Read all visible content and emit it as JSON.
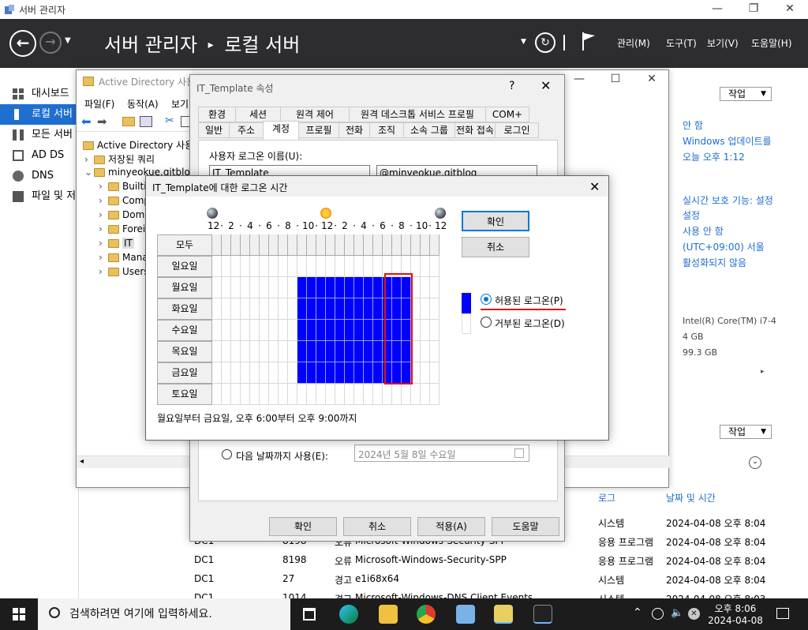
{
  "server_manager": {
    "window_title": "서버 관리자",
    "breadcrumb_root": "서버 관리자",
    "breadcrumb_sep": "▸",
    "breadcrumb_page": "로컬 서버",
    "menus": [
      "관리(M)",
      "도구(T)",
      "보기(V)",
      "도움말(H)"
    ],
    "sidebar": [
      "대시보드",
      "로컬 서버",
      "모든 서버",
      "AD DS",
      "DNS",
      "파일 및 저장소 서비스"
    ],
    "right_panel": {
      "task_label": "작업",
      "lines": [
        "안 함",
        "Windows 업데이트를",
        "오늘 오후 1:12",
        "실시간 보호 기능: 설정",
        "설정",
        "사용 안 함",
        "(UTC+09:00) 서울",
        "활성화되지 않음",
        "Intel(R) Core(TM) i7-4",
        "4 GB",
        "99.3 GB"
      ],
      "task_label2": "작업"
    },
    "events": {
      "col_log": "로그",
      "col_datetime": "날짜 및 시간",
      "rows": [
        {
          "server": "",
          "id": "",
          "level": "",
          "source": "",
          "log": "시스템",
          "time": "2024-04-08 오후 8:04"
        },
        {
          "server": "DC1",
          "id": "8198",
          "level": "오류",
          "source": "Microsoft-Windows-Security-SPP",
          "log": "응용 프로그램",
          "time": "2024-04-08 오후 8:04"
        },
        {
          "server": "DC1",
          "id": "8198",
          "level": "오류",
          "source": "Microsoft-Windows-Security-SPP",
          "log": "응용 프로그램",
          "time": "2024-04-08 오후 8:04"
        },
        {
          "server": "DC1",
          "id": "27",
          "level": "경고",
          "source": "e1i68x64",
          "log": "시스템",
          "time": "2024-04-08 오후 8:04"
        },
        {
          "server": "DC1",
          "id": "1014",
          "level": "경고",
          "source": "Microsoft-Windows-DNS Client Events",
          "log": "시스템",
          "time": "2024-04-08 오후 8:03"
        }
      ]
    }
  },
  "ad_window": {
    "title": "Active Directory 사용자 및 컴퓨터",
    "menus": [
      "파일(F)",
      "동작(A)",
      "보기"
    ],
    "tree": [
      {
        "label": "Active Directory 사용자",
        "indent": 0
      },
      {
        "label": "저장된 쿼리",
        "indent": 1
      },
      {
        "label": "minyeokue.gitblog",
        "indent": 1
      },
      {
        "label": "Builtin",
        "indent": 2
      },
      {
        "label": "Computers",
        "indent": 2
      },
      {
        "label": "Domain",
        "indent": 2
      },
      {
        "label": "Foreign",
        "indent": 2
      },
      {
        "label": "IT",
        "indent": 2
      },
      {
        "label": "Managed",
        "indent": 2
      },
      {
        "label": "Users",
        "indent": 2
      }
    ]
  },
  "properties": {
    "title": "IT_Template 속성",
    "help": "?",
    "tabs_row1": [
      "환경",
      "세션",
      "원격 제어",
      "원격 데스크톱 서비스 프로필",
      "COM+"
    ],
    "tabs_row2": [
      "일반",
      "주소",
      "계정",
      "프로필",
      "전화",
      "조직",
      "소속 그룹",
      "전화 접속",
      "로그인"
    ],
    "logon_name_label": "사용자 로그온 이름(U):",
    "logon_name_value": "IT_Template",
    "domain_value": "@minyeokue.gitblog",
    "expire_option": "다음 날짜까지 사용(E):",
    "expire_date": "2024년   5월   8일 수요일",
    "buttons": [
      "확인",
      "취소",
      "적용(A)",
      "도움말"
    ]
  },
  "logon_hours": {
    "title": "IT_Template에 대한 로그온 시간",
    "all_label": "모두",
    "hour_labels": [
      "12",
      "·",
      "2",
      "·",
      "4",
      "·",
      "6",
      "·",
      "8",
      "·",
      "10",
      "·",
      "12",
      "·",
      "2",
      "·",
      "4",
      "·",
      "6",
      "·",
      "8",
      "·",
      "10",
      "·",
      "12"
    ],
    "days": [
      "일요일",
      "월요일",
      "화요일",
      "수요일",
      "목요일",
      "금요일",
      "토요일"
    ],
    "allowed": [
      [],
      [
        9,
        10,
        11,
        12,
        13,
        14,
        15,
        16,
        17,
        18,
        19,
        20
      ],
      [
        9,
        10,
        11,
        12,
        13,
        14,
        15,
        16,
        17,
        18,
        19,
        20
      ],
      [
        9,
        10,
        11,
        12,
        13,
        14,
        15,
        16,
        17,
        18,
        19,
        20
      ],
      [
        9,
        10,
        11,
        12,
        13,
        14,
        15,
        16,
        17,
        18,
        19,
        20
      ],
      [
        9,
        10,
        11,
        12,
        13,
        14,
        15,
        16,
        17,
        18,
        19,
        20
      ],
      []
    ],
    "ok": "확인",
    "cancel": "취소",
    "allowed_label": "허용된 로그온(P)",
    "denied_label": "거부된 로그온(D)",
    "status": "월요일부터 금요일, 오후 6:00부터 오후 9:00까지",
    "accent_color": "#0000ff",
    "highlight_color": "#e01010"
  },
  "taskbar": {
    "search_placeholder": "검색하려면 여기에 입력하세요.",
    "time": "오후 8:06",
    "date": "2024-04-08"
  }
}
